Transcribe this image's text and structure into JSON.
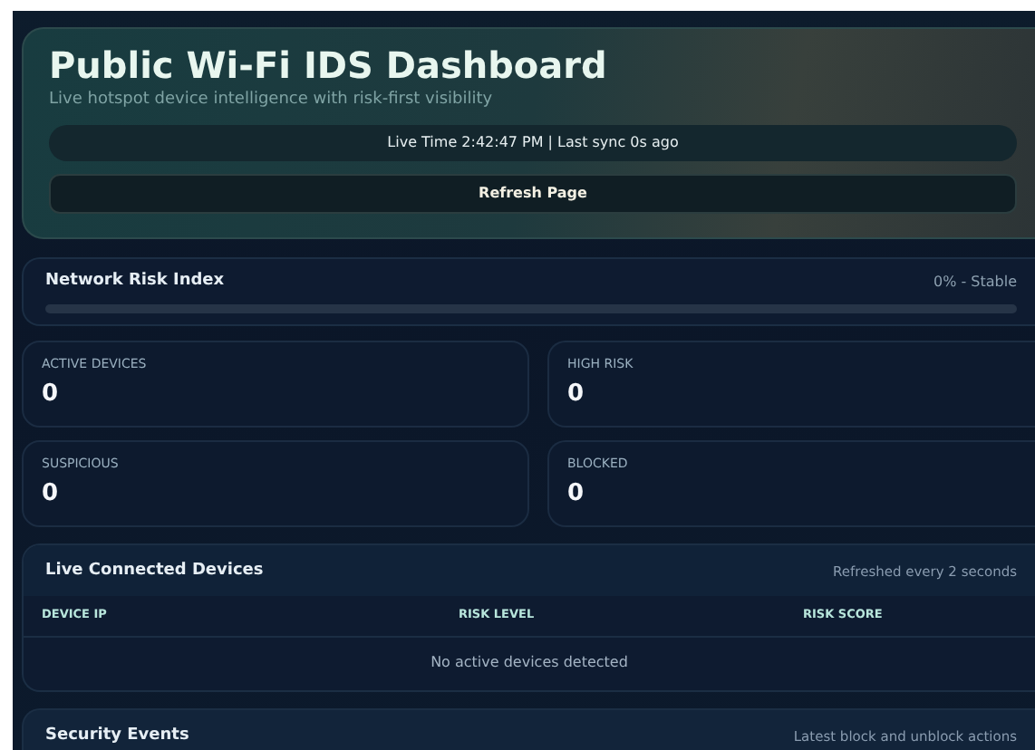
{
  "header": {
    "title": "Public Wi-Fi IDS Dashboard",
    "subtitle": "Live hotspot device intelligence with risk-first visibility",
    "live_status": "Live Time 2:42:47 PM | Last sync 0s ago",
    "refresh_button": "Refresh Page"
  },
  "risk_index": {
    "title": "Network Risk Index",
    "reading": "0% - Stable",
    "level": 0
  },
  "stats": [
    {
      "label": "ACTIVE DEVICES",
      "value": "0"
    },
    {
      "label": "HIGH RISK",
      "value": "0"
    },
    {
      "label": "SUSPICIOUS",
      "value": "0"
    },
    {
      "label": "BLOCKED",
      "value": "0"
    }
  ],
  "devices": {
    "title": "Live Connected Devices",
    "note": "Refreshed every 2 seconds",
    "columns": [
      "DEVICE IP",
      "RISK LEVEL",
      "RISK SCORE"
    ],
    "empty_message": "No active devices detected"
  },
  "events": {
    "title": "Security Events",
    "note": "Latest block and unblock actions"
  }
}
